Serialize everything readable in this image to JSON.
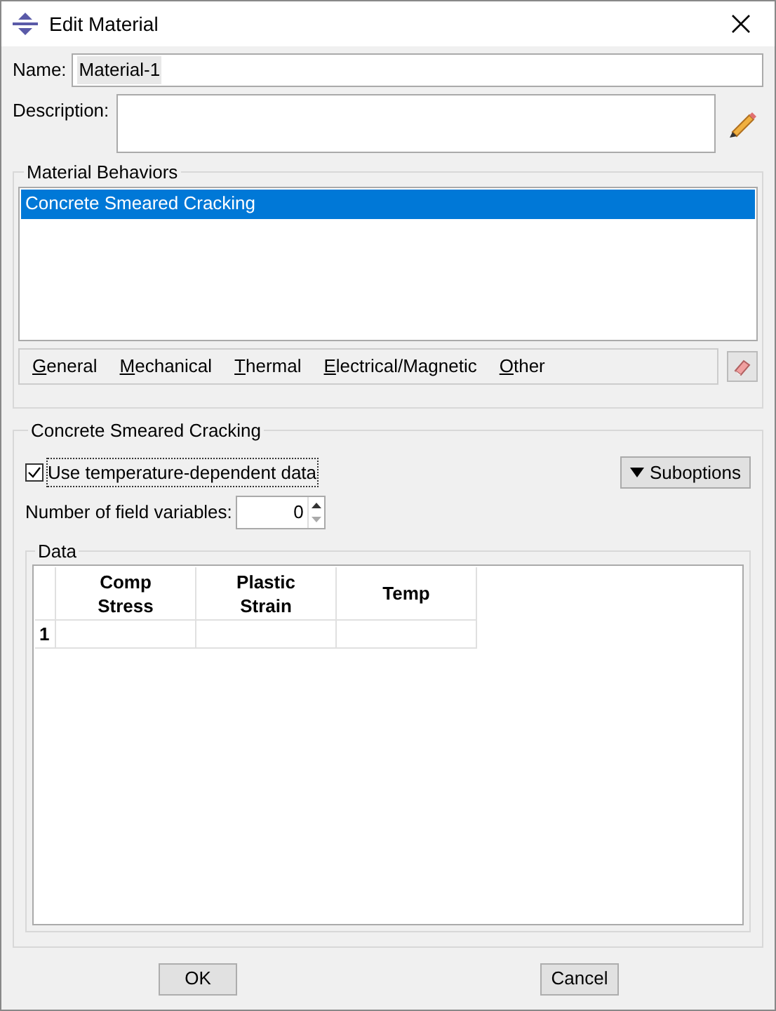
{
  "window": {
    "title": "Edit Material"
  },
  "name": {
    "label": "Name:",
    "value": "Material-1"
  },
  "description": {
    "label": "Description:"
  },
  "behaviors": {
    "title": "Material Behaviors",
    "items": [
      {
        "label": "Concrete Smeared Cracking",
        "selected": true
      }
    ]
  },
  "menus": [
    "General",
    "Mechanical",
    "Thermal",
    "Electrical/Magnetic",
    "Other"
  ],
  "section": {
    "title": "Concrete Smeared Cracking",
    "temperature_checkbox": {
      "label": "Use temperature-dependent data",
      "checked": true
    },
    "suboptions": "Suboptions",
    "field_variables": {
      "label": "Number of field variables:",
      "value": "0"
    },
    "data": {
      "title": "Data",
      "columns": [
        "Comp\nStress",
        "Plastic\nStrain",
        "Temp"
      ],
      "rows": [
        {
          "number": "1",
          "cells": [
            "",
            "",
            ""
          ]
        }
      ]
    }
  },
  "buttons": [
    "OK",
    "Cancel"
  ]
}
